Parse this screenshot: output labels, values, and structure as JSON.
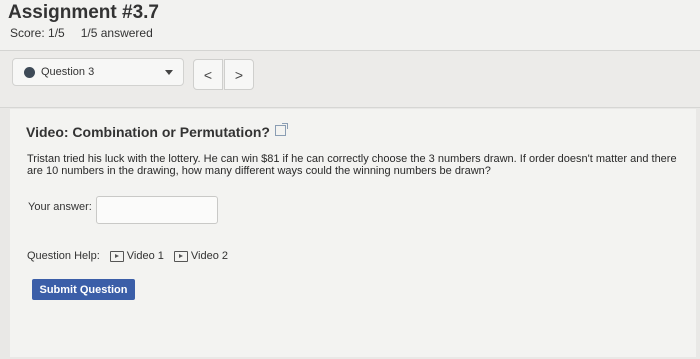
{
  "header": {
    "title": "Assignment #3.7",
    "score": "Score: 1/5",
    "answered": "1/5 answered"
  },
  "nav": {
    "question_label": "Question 3",
    "prev": "<",
    "next": ">"
  },
  "question": {
    "heading": "Video: Combination or Permutation?",
    "text": "Tristan tried his luck with the lottery. He can win $81 if he can correctly choose the 3 numbers drawn. If order doesn't matter and there are 10 numbers in the drawing, how many different ways could the winning numbers be drawn?",
    "answer_label": "Your answer:",
    "answer_value": ""
  },
  "help": {
    "label": "Question Help:",
    "video1": "Video 1",
    "video2": "Video 2"
  },
  "submit_label": "Submit Question",
  "colors": {
    "accent": "#3b5ea8",
    "question_dot": "#3e4a57"
  }
}
